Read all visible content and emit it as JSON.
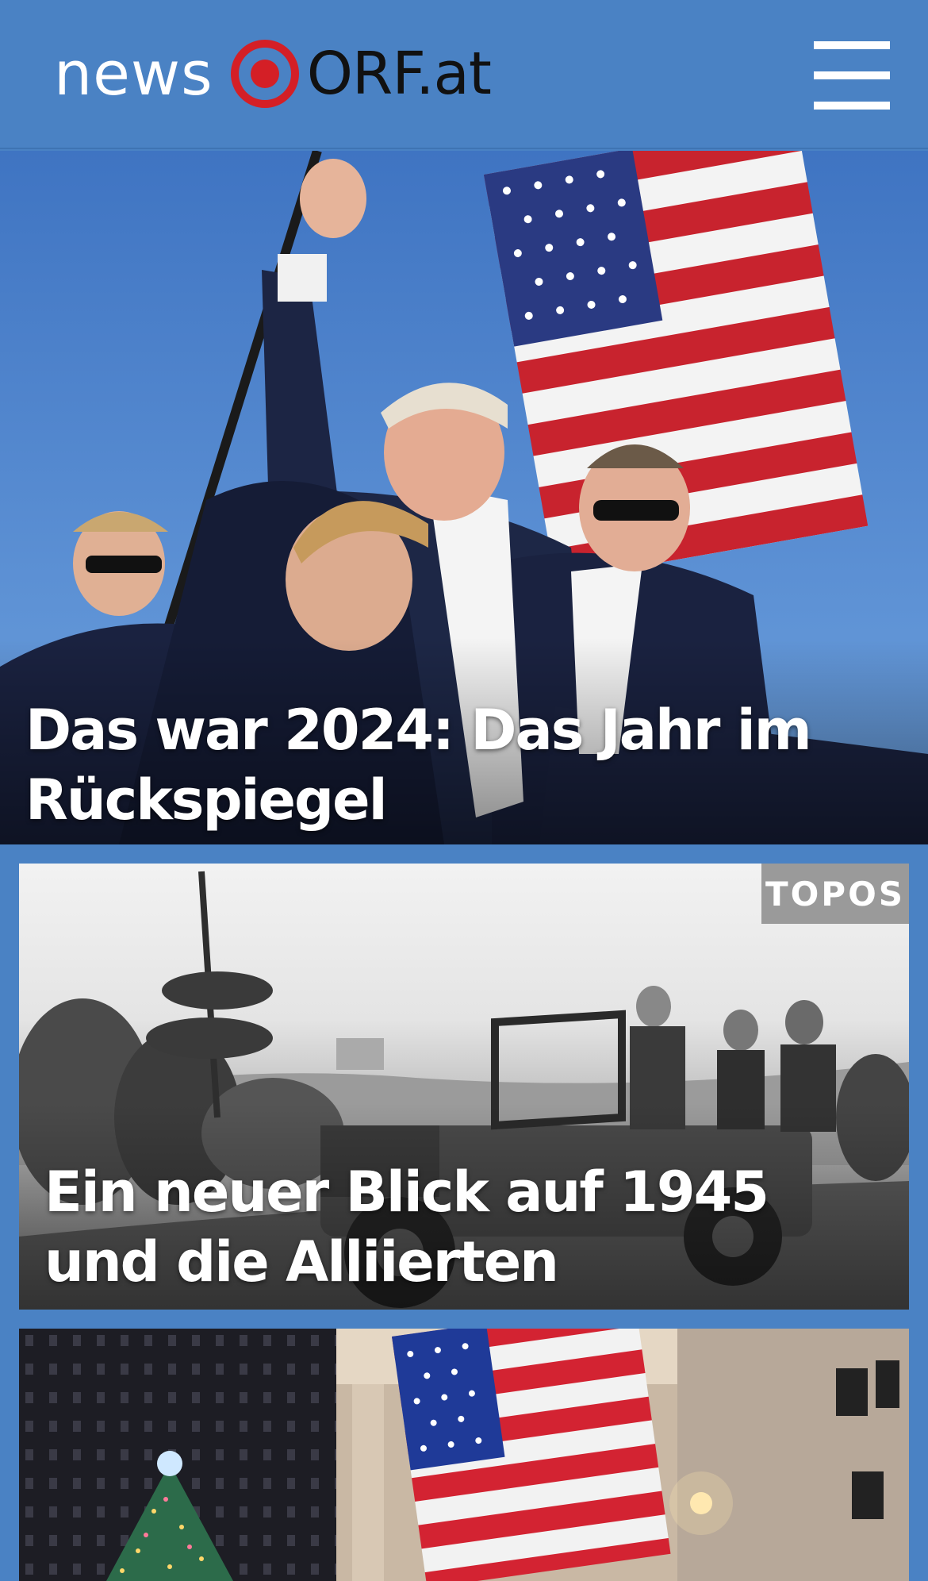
{
  "header": {
    "logo_news": "news",
    "logo_orf": "ORF.at",
    "menu_icon": "hamburger-menu-icon"
  },
  "stories": [
    {
      "headline": "Das war 2024: Das Jahr im Rückspiegel"
    },
    {
      "badge": "TOPOS",
      "headline": "Ein neuer Blick auf 1945 und die Alliierten"
    },
    {
      "headline": ""
    }
  ],
  "colors": {
    "header_bg": "#4a82c4",
    "logo_red": "#d41f26",
    "badge_bg": "#9a9a9a"
  }
}
